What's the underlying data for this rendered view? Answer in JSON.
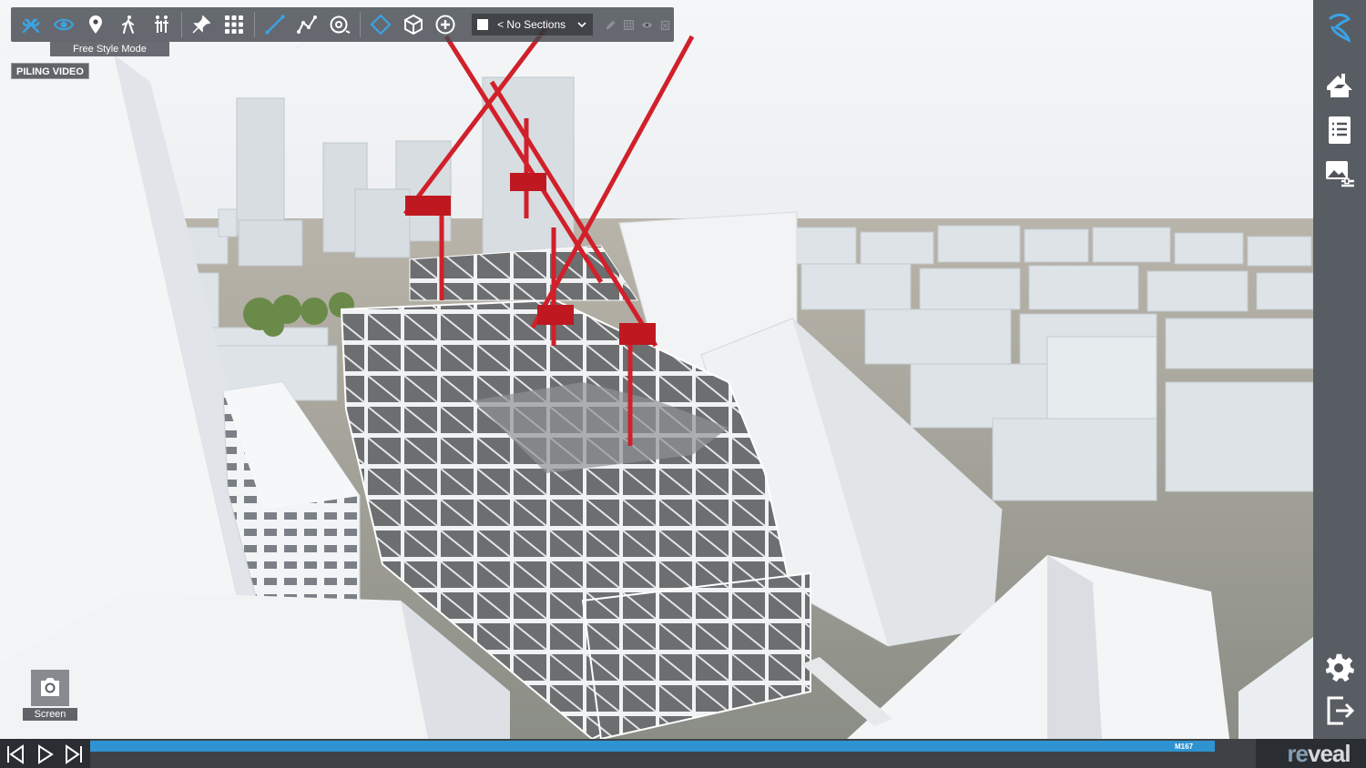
{
  "toolbar": {
    "tools": [
      {
        "name": "tools-icon",
        "active": true
      },
      {
        "name": "eye-icon",
        "active": true
      },
      {
        "name": "map-pin-icon",
        "active": false
      },
      {
        "name": "walk-icon",
        "active": false
      },
      {
        "name": "people-icon",
        "active": false
      },
      {
        "name": "pin-icon",
        "active": false
      },
      {
        "name": "grid-icon",
        "active": false
      },
      {
        "name": "measure-line-icon",
        "active": true
      },
      {
        "name": "polyline-icon",
        "active": false
      },
      {
        "name": "orbit-icon",
        "active": false
      },
      {
        "name": "plane-section-icon",
        "active": true
      },
      {
        "name": "box-section-icon",
        "active": false
      },
      {
        "name": "add-section-icon",
        "active": false
      }
    ],
    "sections_value": "< No Sections",
    "tooltip": "Free Style Mode"
  },
  "overlay": {
    "piling_label": "PILING VIDEO",
    "screen_label": "Screen"
  },
  "sidebar": {
    "items": [
      "logo-icon",
      "home-view-icon",
      "list-icon",
      "image-settings-icon",
      "settings-icon",
      "exit-icon"
    ]
  },
  "timeline": {
    "progress": 0.965,
    "marker_label": "M167"
  },
  "brand": {
    "name_part1": "re",
    "name_part2": "veal"
  },
  "colors": {
    "accent": "#2f93d1",
    "crane": "#d1202a",
    "sky": "#eef2f5",
    "toolbar_bg": "#464a50"
  }
}
